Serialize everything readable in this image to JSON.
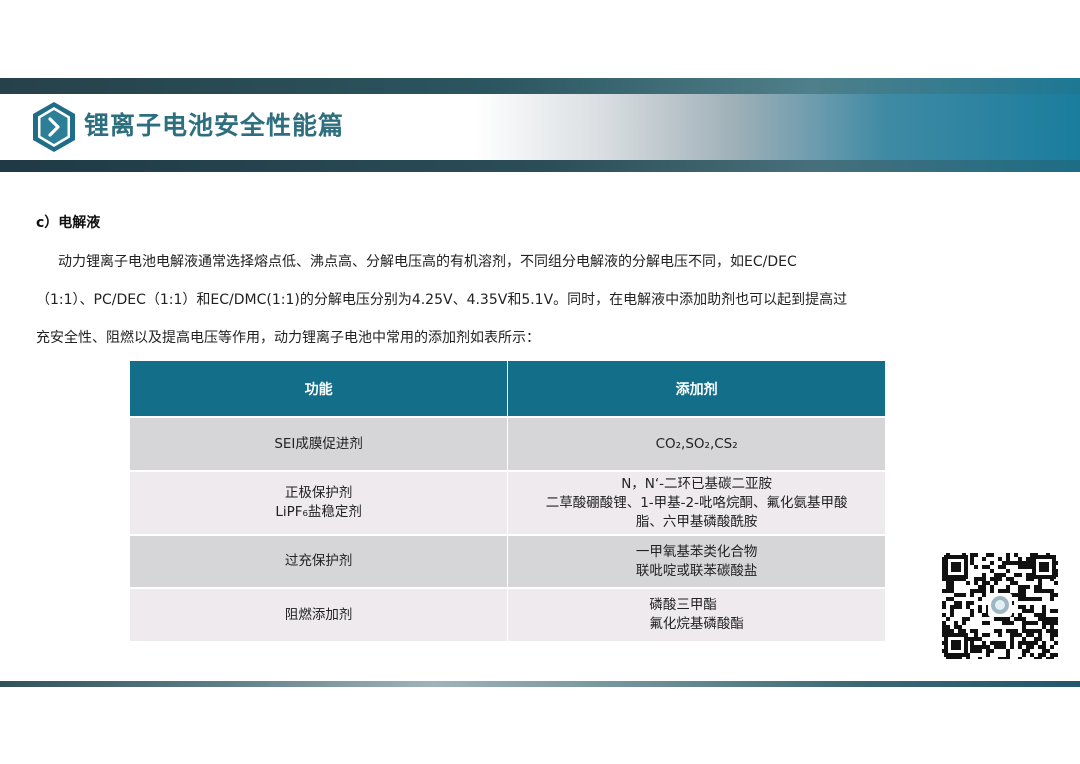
{
  "header": {
    "title": "锂离子电池安全性能篇",
    "badge_icon": "chevron-right-icon",
    "accent_color": "#2d6f7e"
  },
  "section": {
    "heading": "c）电解液",
    "lines": [
      "动力锂离子电池电解液通常选择熔点低、沸点高、分解电压高的有机溶剂，不同组分电解液的分解电压不同，如EC/DEC",
      "（1:1）、PC/DEC（1:1）和EC/DMC(1:1)的分解电压分别为4.25V、4.35V和5.1V。同时，在电解液中添加助剂也可以起到提高过",
      "充安全性、阻燃以及提高电压等作用，动力锂离子电池中常用的添加剂如表所示："
    ]
  },
  "table": {
    "header_color": "#136e89",
    "columns": [
      "功能",
      "添加剂"
    ],
    "rows": [
      {
        "function": [
          "SEI成膜促进剂"
        ],
        "additive": [
          "CO₂,SO₂,CS₂"
        ]
      },
      {
        "function": [
          "正极保护剂",
          "LiPF₆盐稳定剂"
        ],
        "additive": [
          "N，N‘-二环已基碳二亚胺",
          "二草酸硼酸锂、1-甲基-2-吡咯烷酮、氟化氨基甲酸",
          "脂、六甲基磷酸酰胺"
        ]
      },
      {
        "function": [
          "过充保护剂"
        ],
        "additive": [
          "一甲氧基苯类化合物",
          "联吡啶或联苯碳酸盐"
        ]
      },
      {
        "function": [
          "阻燃添加剂"
        ],
        "additive": [
          "磷酸三甲酯",
          "氟化烷基磷酸酯"
        ]
      }
    ]
  },
  "qr_icon": "qr-code-icon"
}
